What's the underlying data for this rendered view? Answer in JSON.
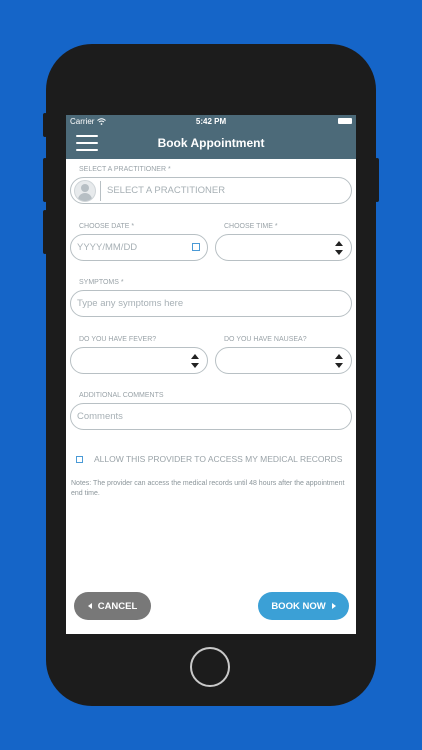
{
  "status_bar": {
    "carrier": "Carrier",
    "time": "5:42 PM"
  },
  "header": {
    "title": "Book Appointment"
  },
  "form": {
    "practitioner_label": "SELECT A PRACTITIONER *",
    "practitioner_placeholder": "SELECT A PRACTITIONER",
    "date_label": "CHOOSE DATE *",
    "date_placeholder": "YYYY/MM/DD",
    "time_label": "CHOOSE TIME *",
    "time_value": "",
    "symptoms_label": "SYMPTOMS *",
    "symptoms_placeholder": "Type any symptoms here",
    "fever_label": "DO YOU HAVE FEVER?",
    "fever_value": "",
    "nausea_label": "DO YOU HAVE NAUSEA?",
    "nausea_value": "",
    "comments_label": "ADDITIONAL COMMENTS",
    "comments_placeholder": "Comments",
    "allow_records_label": "ALLOW THIS PROVIDER TO ACCESS MY MEDICAL RECORDS",
    "notes": "Notes: The provider can access the medical records until 48 hours after the appointment end time."
  },
  "actions": {
    "cancel_label": "CANCEL",
    "book_label": "BOOK NOW"
  },
  "colors": {
    "background": "#1565c8",
    "header": "#4c6a79",
    "accent": "#3ba0d6",
    "cancel": "#787878"
  },
  "icons": [
    "menu-icon",
    "wifi-icon",
    "battery-icon",
    "avatar-icon",
    "calendar-icon",
    "select-arrows-icon",
    "checkbox-icon"
  ]
}
